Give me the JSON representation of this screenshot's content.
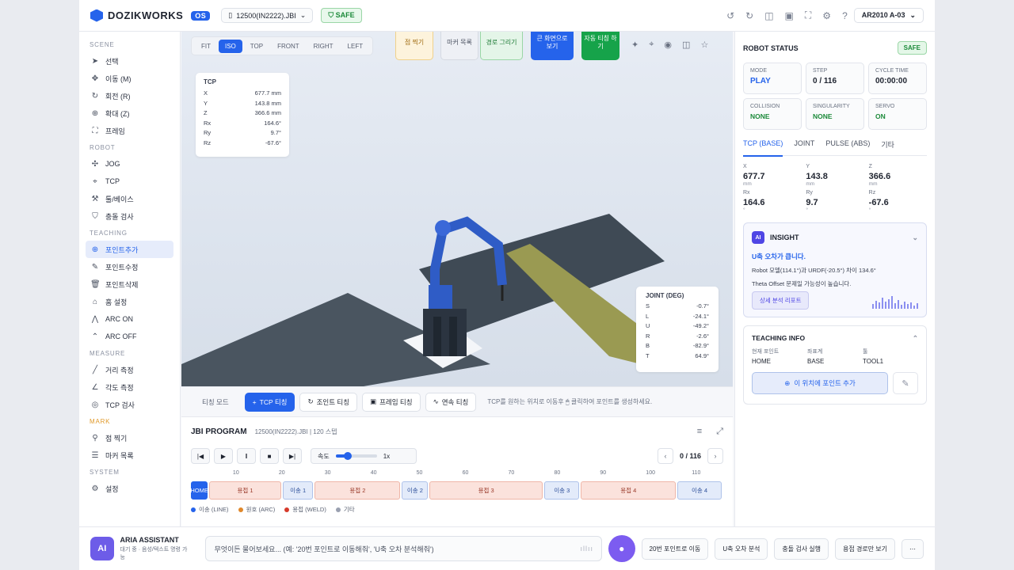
{
  "header": {
    "brand": "DOZIKWORKS",
    "version_badge": "OS",
    "file_name": "12500(IN2222).JBI",
    "safe_label": "SAFE",
    "model": "AR2010 A-03"
  },
  "sidebar": {
    "sections": [
      {
        "title": "SCENE",
        "items": [
          {
            "label": "선택",
            "icon": "cursor-icon"
          },
          {
            "label": "이동 (M)",
            "icon": "move-icon"
          },
          {
            "label": "회전 (R)",
            "icon": "rotate-icon"
          },
          {
            "label": "확대 (Z)",
            "icon": "zoom-icon"
          },
          {
            "label": "프레임",
            "icon": "frame-icon"
          }
        ]
      },
      {
        "title": "ROBOT",
        "items": [
          {
            "label": "JOG",
            "icon": "jog-icon"
          },
          {
            "label": "TCP",
            "icon": "tcp-icon"
          },
          {
            "label": "툴/베이스",
            "icon": "tool-icon"
          },
          {
            "label": "충돌 검사",
            "icon": "shield-icon"
          }
        ]
      },
      {
        "title": "TEACHING",
        "items": [
          {
            "label": "포인트추가",
            "icon": "plus-circle-icon",
            "active": true
          },
          {
            "label": "포인트수정",
            "icon": "edit-icon"
          },
          {
            "label": "포인트삭제",
            "icon": "trash-icon"
          },
          {
            "label": "홈 설정",
            "icon": "home-icon"
          },
          {
            "label": "ARC ON",
            "icon": "arc-on-icon"
          },
          {
            "label": "ARC OFF",
            "icon": "arc-off-icon"
          }
        ]
      },
      {
        "title": "MEASURE",
        "items": [
          {
            "label": "거리 측정",
            "icon": "ruler-icon"
          },
          {
            "label": "각도 측정",
            "icon": "angle-icon"
          },
          {
            "label": "TCP 검사",
            "icon": "target-icon"
          }
        ]
      },
      {
        "title": "MARK",
        "items": [
          {
            "label": "점 찍기",
            "icon": "pin-icon"
          },
          {
            "label": "마커 목록",
            "icon": "list-icon"
          }
        ]
      },
      {
        "title": "SYSTEM",
        "items": [
          {
            "label": "설정",
            "icon": "gear-icon"
          }
        ]
      }
    ]
  },
  "viewport": {
    "view_tabs": [
      "FIT",
      "ISO",
      "TOP",
      "FRONT",
      "RIGHT",
      "LEFT"
    ],
    "active_view": "ISO",
    "tools": [
      {
        "label": "점 찍기"
      },
      {
        "label": "마커 목록"
      },
      {
        "label": "경로 그리기"
      },
      {
        "label": "큰 화면으로 보기"
      },
      {
        "label": "자동 티칭 하기"
      }
    ],
    "tcp": {
      "title": "TCP",
      "rows": [
        {
          "k": "X",
          "v": "677.7 mm"
        },
        {
          "k": "Y",
          "v": "143.8 mm"
        },
        {
          "k": "Z",
          "v": "366.6 mm"
        },
        {
          "k": "Rx",
          "v": "164.6°"
        },
        {
          "k": "Ry",
          "v": "9.7°"
        },
        {
          "k": "Rz",
          "v": "-67.6°"
        }
      ]
    },
    "joint": {
      "title": "JOINT (DEG)",
      "rows": [
        {
          "k": "S",
          "v": "-0.7°"
        },
        {
          "k": "L",
          "v": "-24.1°"
        },
        {
          "k": "U",
          "v": "-49.2°"
        },
        {
          "k": "R",
          "v": "-2.6°"
        },
        {
          "k": "B",
          "v": "-82.9°"
        },
        {
          "k": "T",
          "v": "64.9°"
        }
      ]
    }
  },
  "teach_bar": {
    "mode_label": "티칭 모드",
    "buttons": [
      "TCP 티칭",
      "조인트 티칭",
      "프레임 티칭",
      "연속 티칭"
    ],
    "hint": "TCP를 원하는 위치로 이동후 🖱 클릭하여 포인트를 생성하세요."
  },
  "program": {
    "title": "JBI PROGRAM",
    "subtitle": "12500(IN2222).JBI | 120 스텝",
    "speed_label": "속도",
    "speed_value": "1x",
    "speed_fraction": 0.3,
    "step_display": "0 / 116",
    "ruler": [
      "10",
      "20",
      "30",
      "40",
      "50",
      "60",
      "70",
      "80",
      "90",
      "100",
      "110"
    ],
    "segments": [
      {
        "label": "HOME",
        "kind": "home",
        "start": 0,
        "end": 4
      },
      {
        "label": "용접 1",
        "kind": "weld",
        "start": 4,
        "end": 20
      },
      {
        "label": "이송 1",
        "kind": "move",
        "start": 20,
        "end": 27
      },
      {
        "label": "용접 2",
        "kind": "weld",
        "start": 27,
        "end": 46
      },
      {
        "label": "이송 2",
        "kind": "move",
        "start": 46,
        "end": 52
      },
      {
        "label": "용접 3",
        "kind": "weld",
        "start": 52,
        "end": 77
      },
      {
        "label": "이송 3",
        "kind": "move",
        "start": 77,
        "end": 85
      },
      {
        "label": "용접 4",
        "kind": "weld",
        "start": 85,
        "end": 106
      },
      {
        "label": "이송 4",
        "kind": "move",
        "start": 106,
        "end": 116
      }
    ],
    "legend": [
      {
        "label": "이송 (LINE)",
        "color": "#2563eb"
      },
      {
        "label": "원호 (ARC)",
        "color": "#e0882b"
      },
      {
        "label": "용접 (WELD)",
        "color": "#d63a2a"
      },
      {
        "label": "기타",
        "color": "#9aa0b0"
      }
    ]
  },
  "robot_status": {
    "title": "ROBOT STATUS",
    "safe": "SAFE",
    "stats": [
      {
        "label": "MODE",
        "value": "PLAY",
        "style": "blue"
      },
      {
        "label": "STEP",
        "value": "0 / 116",
        "style": ""
      },
      {
        "label": "CYCLE TIME",
        "value": "00:00:00",
        "style": ""
      },
      {
        "label": "COLLISION",
        "value": "NONE",
        "style": "green"
      },
      {
        "label": "SINGULARITY",
        "value": "NONE",
        "style": "green"
      },
      {
        "label": "SERVO",
        "value": "ON",
        "style": "green"
      }
    ],
    "tabs": [
      "TCP (BASE)",
      "JOINT",
      "PULSE (ABS)",
      "기타"
    ],
    "coords": [
      {
        "k": "X",
        "v": "677.7",
        "u": "mm"
      },
      {
        "k": "Y",
        "v": "143.8",
        "u": "mm"
      },
      {
        "k": "Z",
        "v": "366.6",
        "u": "mm"
      },
      {
        "k": "Rx",
        "v": "164.6",
        "u": "°"
      },
      {
        "k": "Ry",
        "v": "9.7",
        "u": "°"
      },
      {
        "k": "Rz",
        "v": "-67.6",
        "u": "°"
      }
    ]
  },
  "insight": {
    "title": "INSIGHT",
    "headline": "U축 오차가 큽니다.",
    "line1": "Robot 모델(114.1°)과 URDF(-20.5°) 차이 134.6°",
    "line2": "Theta Offset 문제일 가능성이 높습니다.",
    "button": "상세 분석 리포트"
  },
  "teaching_info": {
    "title": "TEACHING INFO",
    "fields": [
      {
        "label": "현재 포인트",
        "value": "HOME"
      },
      {
        "label": "좌표계",
        "value": "BASE"
      },
      {
        "label": "툴",
        "value": "TOOL1"
      }
    ],
    "add_button": "이 위치에 포인트 추가"
  },
  "assistant": {
    "name": "ARIA ASSISTANT",
    "status": "대기 중 · 음성/텍스트 명령 가능",
    "avatar": "AI",
    "placeholder": "무엇이든 물어보세요... (예: '20번 포인트로 이동해줘', 'U축 오차 분석해줘')",
    "quick": [
      "20번 포인트로 이동",
      "U축 오차 분석",
      "충돌 검사 실행",
      "용접 경로만 보기"
    ]
  }
}
